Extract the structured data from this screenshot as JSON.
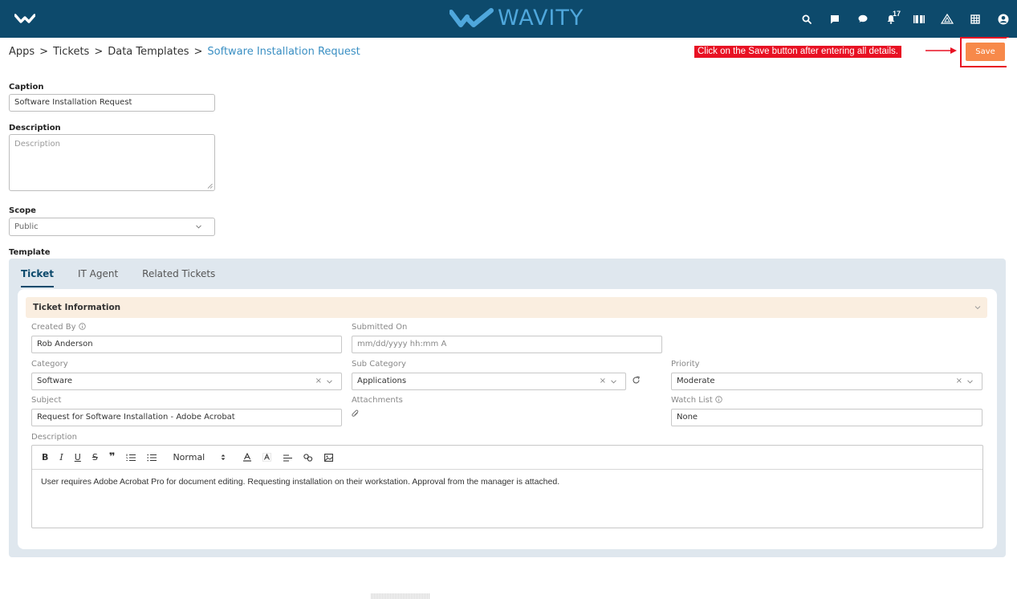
{
  "header": {
    "brand": "WAVITY",
    "notifications_count": "17",
    "icons": [
      "menu-logo-icon",
      "search-icon",
      "message-icon",
      "chat-icon",
      "bell-icon",
      "book-icon",
      "alert-triangle-icon",
      "grid-icon",
      "user-icon"
    ]
  },
  "breadcrumb": {
    "items": [
      "Apps",
      "Tickets",
      "Data Templates"
    ],
    "separator": ">",
    "current": "Software Installation Request"
  },
  "annotation": {
    "text": "Click on the Save button after entering all details."
  },
  "toolbar": {
    "save_label": "Save"
  },
  "form": {
    "caption_label": "Caption",
    "caption_value": "Software Installation Request",
    "description_label": "Description",
    "description_placeholder": "Description",
    "scope_label": "Scope",
    "scope_value": "Public",
    "template_label": "Template"
  },
  "template": {
    "tabs": [
      "Ticket",
      "IT Agent",
      "Related Tickets"
    ],
    "active_tab": "Ticket",
    "section_title": "Ticket Information",
    "fields": {
      "created_by_label": "Created By",
      "created_by_value": "Rob Anderson",
      "submitted_on_label": "Submitted On",
      "submitted_on_placeholder": "mm/dd/yyyy hh:mm A",
      "category_label": "Category",
      "category_value": "Software",
      "sub_category_label": "Sub Category",
      "sub_category_value": "Applications",
      "priority_label": "Priority",
      "priority_value": "Moderate",
      "subject_label": "Subject",
      "subject_value": "Request for Software Installation - Adobe Acrobat",
      "attachments_label": "Attachments",
      "watch_list_label": "Watch List",
      "watch_list_value": "None",
      "description_label": "Description"
    },
    "editor": {
      "toolbar": {
        "bold": "B",
        "italic": "I",
        "underline": "U",
        "strike": "S",
        "quote": "❞",
        "format": "Normal"
      },
      "content": "User requires Adobe Acrobat Pro for document editing. Requesting installation on their workstation. Approval from the manager is attached."
    }
  },
  "colors": {
    "header_bg": "#0d4a6c",
    "brand": "#4fa7dc",
    "save_button": "#f7894a",
    "annotation": "#e81123",
    "section_header": "#faeee0",
    "panel_bg": "#dfe7ee"
  }
}
